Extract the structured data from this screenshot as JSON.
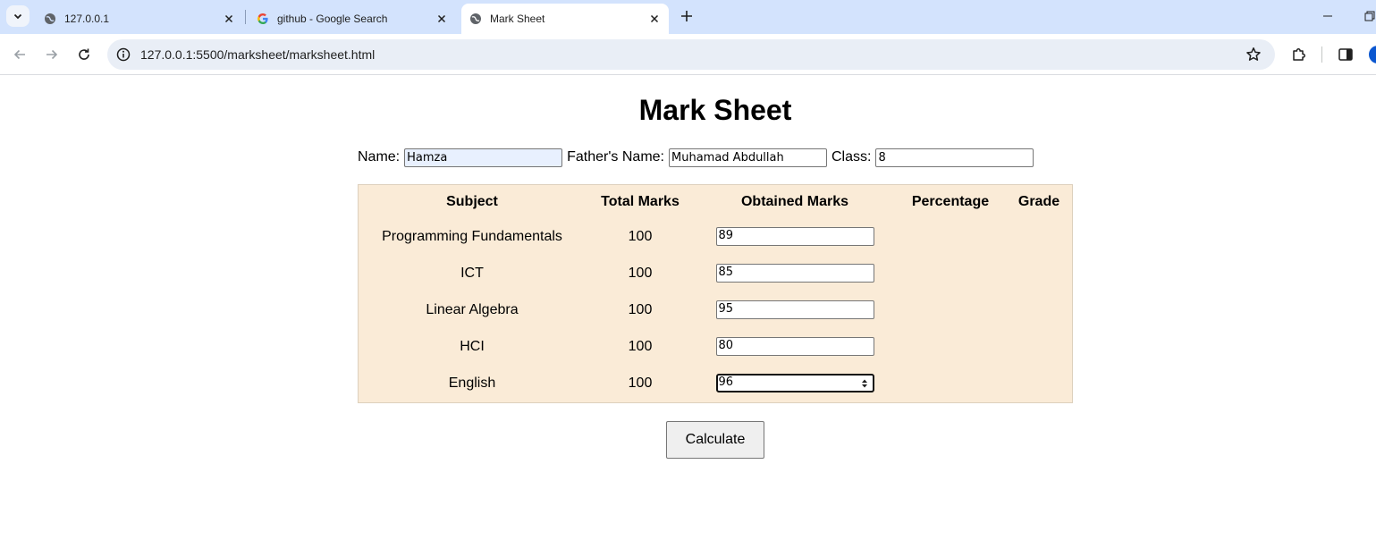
{
  "browser": {
    "tabs": [
      {
        "title": "127.0.0.1",
        "favicon": "globe-icon"
      },
      {
        "title": "github - Google Search",
        "favicon": "google-g-icon"
      },
      {
        "title": "Mark Sheet",
        "favicon": "globe-icon"
      }
    ],
    "url": "127.0.0.1:5500/marksheet/marksheet.html",
    "colors": {
      "tabstrip": "#d3e3fd",
      "omnibox": "#e9eef6",
      "accent": "#0b57d0"
    }
  },
  "page": {
    "title": "Mark Sheet",
    "name_label": "Name:",
    "name_value": "Hamza",
    "father_label": "Father's Name:",
    "father_value": "Muhamad Abdullah",
    "class_label": "Class:",
    "class_value": "8",
    "table_bg": "#faebd7",
    "headers": {
      "subject": "Subject",
      "total": "Total Marks",
      "obtained": "Obtained Marks",
      "percentage": "Percentage",
      "grade": "Grade"
    },
    "rows": [
      {
        "subject": "Programming Fundamentals",
        "total": "100",
        "obtained": "89"
      },
      {
        "subject": "ICT",
        "total": "100",
        "obtained": "85"
      },
      {
        "subject": "Linear Algebra",
        "total": "100",
        "obtained": "95"
      },
      {
        "subject": "HCI",
        "total": "100",
        "obtained": "80"
      },
      {
        "subject": "English",
        "total": "100",
        "obtained": "96"
      }
    ],
    "calculate_label": "Calculate"
  }
}
